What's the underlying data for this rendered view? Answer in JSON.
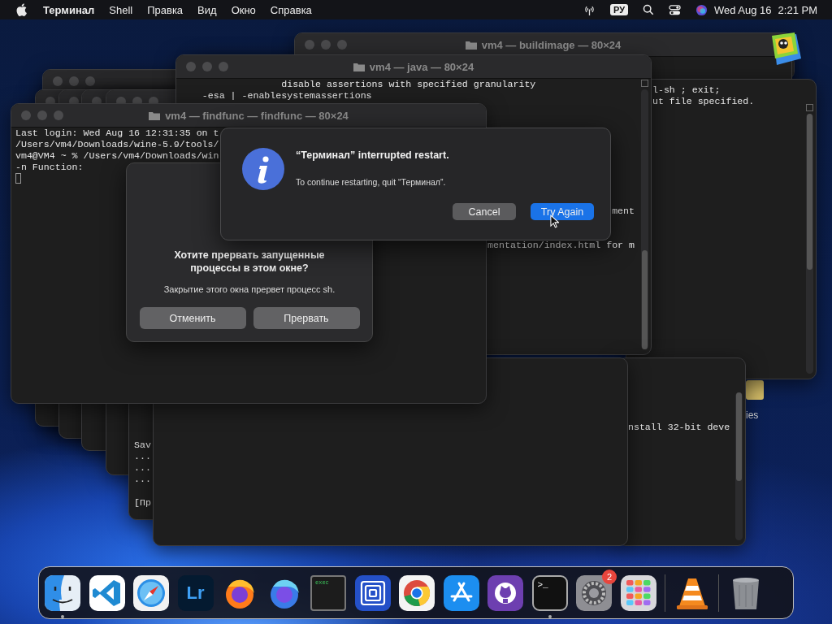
{
  "menu_bar": {
    "app_name": "Терминал",
    "menus": [
      "Shell",
      "Правка",
      "Вид",
      "Окно",
      "Справка"
    ],
    "input_source": "РУ",
    "date": "Wed Aug 16",
    "time": "2:21 PM"
  },
  "desktop": {
    "file_label": "ies"
  },
  "windows": [
    {
      "title": "vm4 — buildimage — 80×24"
    },
    {
      "lines": [
        "l-sh ; exit;",
        "ut file specified."
      ]
    },
    {
      "title": "vm4 — java — 80×24",
      "lines": [
        "                  disable assertions with specified granularity",
        "    -esa | -enablesystemassertions"
      ],
      "clipped_lines": [
        "ment",
        "mentation/index.html for m"
      ]
    },
    {
      "lines": [
        "nstall 32-bit deve"
      ]
    },
    {
      "lines": [
        "Sav",
        "...",
        "...",
        "..."
      ],
      "footer_line": "[Пр"
    },
    {
      "title": "vm4 — findfunc — findfunc — 80×24",
      "lines": [
        "Last login: Wed Aug 16 12:31:35 on t",
        "/Users/vm4/Downloads/wine-5.9/tools/",
        "vm4@VM4 ~ % /Users/vm4/Downloads/win",
        "-n Function:"
      ],
      "cursor": true
    }
  ],
  "sheet": {
    "title": "Хотите прервать запущенные процессы в этом окне?",
    "message": "Закрытие этого окна прервет процесс sh.",
    "buttons": [
      {
        "label": "Отменить",
        "default": false
      },
      {
        "label": "Прервать",
        "default": false
      }
    ]
  },
  "alert": {
    "title": "“Терминал” interrupted restart.",
    "message": "To continue restarting, quit “Терминал”.",
    "buttons": [
      {
        "label": "Cancel",
        "default": false
      },
      {
        "label": "Try Again",
        "default": true
      }
    ]
  },
  "dock": [
    {
      "kind": "finder",
      "running": true
    },
    {
      "kind": "vscode",
      "running": false
    },
    {
      "kind": "safari",
      "running": false
    },
    {
      "kind": "lightroom",
      "label": "Lr",
      "running": false
    },
    {
      "kind": "firefox",
      "running": false
    },
    {
      "kind": "firefox-dev",
      "running": false
    },
    {
      "kind": "console",
      "label": "exec",
      "running": false
    },
    {
      "kind": "squares",
      "running": false
    },
    {
      "kind": "chrome",
      "running": false
    },
    {
      "kind": "appstore",
      "running": false
    },
    {
      "kind": "github",
      "running": false
    },
    {
      "kind": "terminal",
      "label": ">_",
      "running": true
    },
    {
      "kind": "settings",
      "badge": "2",
      "running": false
    },
    {
      "kind": "launchpad",
      "running": false
    },
    {
      "kind": "separator"
    },
    {
      "kind": "vlc",
      "running": false
    },
    {
      "kind": "separator"
    },
    {
      "kind": "trash",
      "running": false
    }
  ]
}
